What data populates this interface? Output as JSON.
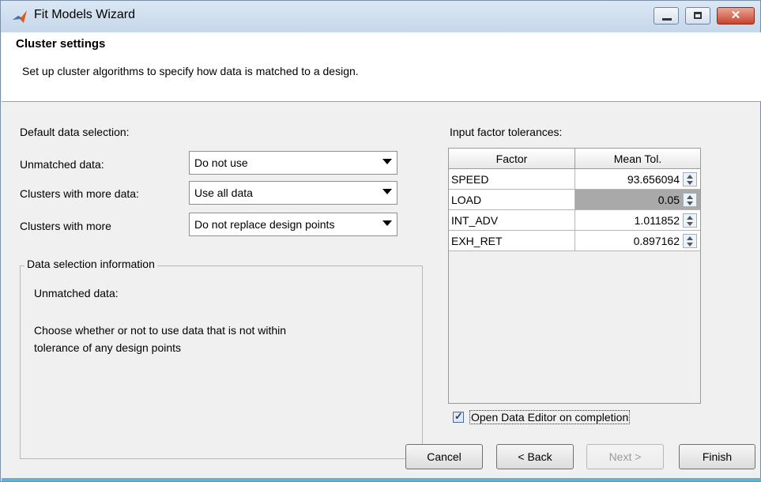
{
  "window": {
    "title": "Fit Models Wizard",
    "close_glyph": "✕"
  },
  "header": {
    "title": "Cluster settings",
    "subtitle": "Set up cluster algorithms to specify how data is matched to a design."
  },
  "data_selection": {
    "heading": "Default data selection:",
    "rows": [
      {
        "label": "Unmatched data:",
        "value": "Do not use"
      },
      {
        "label": "Clusters with more data:",
        "value": "Use all data"
      },
      {
        "label": "Clusters with more",
        "value": "Do not replace design points"
      }
    ]
  },
  "info_group": {
    "legend": "Data selection information",
    "title": "Unmatched data:",
    "line1": "Choose whether or not to use data that is not within",
    "line2": "tolerance of any design points"
  },
  "tolerances": {
    "heading": "Input factor tolerances:",
    "columns": [
      "Factor",
      "Mean Tol."
    ],
    "rows": [
      {
        "factor": "SPEED",
        "tol": "93.656094",
        "selected": false
      },
      {
        "factor": "LOAD",
        "tol": "0.05",
        "selected": true
      },
      {
        "factor": "INT_ADV",
        "tol": "1.011852",
        "selected": false
      },
      {
        "factor": "EXH_RET",
        "tol": "0.897162",
        "selected": false
      }
    ]
  },
  "open_editor": {
    "label": "Open Data Editor on completion",
    "checked": true,
    "mark": "✓"
  },
  "buttons": {
    "cancel": "Cancel",
    "back": "< Back",
    "next": "Next >",
    "finish": "Finish"
  },
  "colors": {
    "header_bg": "#ffffff",
    "window_bg": "#f0f0f0",
    "selected_cell": "#a9a9a9"
  }
}
